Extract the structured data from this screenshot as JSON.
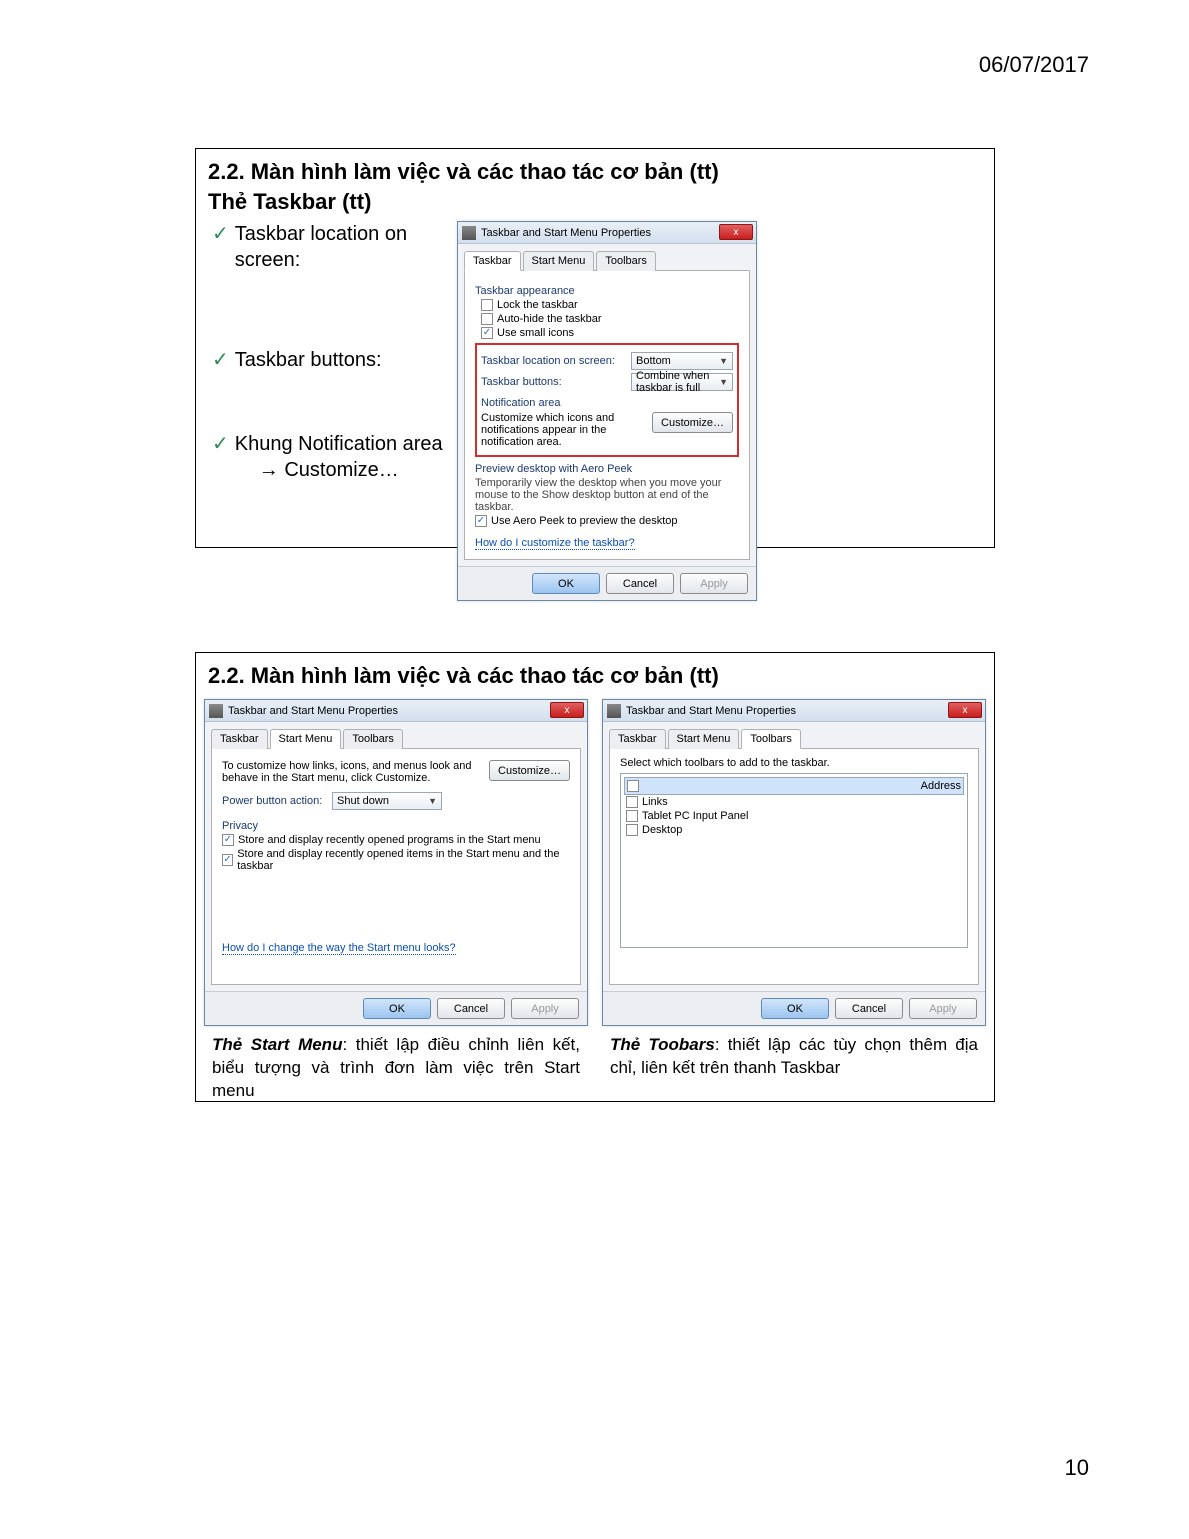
{
  "page": {
    "date": "06/07/2017",
    "number": "10"
  },
  "slide1": {
    "title": "2.2. Màn hình làm việc và các thao tác cơ bản (tt)",
    "subtitle": "Thẻ Taskbar (tt)",
    "bullets": {
      "b1": "Taskbar location on screen:",
      "b2": "Taskbar buttons:",
      "b3": "Khung Notification area",
      "b3sub": "→ Customize…"
    },
    "dlg": {
      "title": "Taskbar and Start Menu Properties",
      "close": "x",
      "tabs": {
        "t1": "Taskbar",
        "t2": "Start Menu",
        "t3": "Toolbars"
      },
      "appearance_head": "Taskbar appearance",
      "c_lock": "Lock the taskbar",
      "c_autohide": "Auto-hide the taskbar",
      "c_smallicons": "Use small icons",
      "loc_label": "Taskbar location on screen:",
      "loc_value": "Bottom",
      "btn_label": "Taskbar buttons:",
      "btn_value": "Combine when taskbar is full",
      "notif_head": "Notification area",
      "notif_text": "Customize which icons and notifications appear in the notification area.",
      "customize": "Customize…",
      "peek_head": "Preview desktop with Aero Peek",
      "peek_text": "Temporarily view the desktop when you move your mouse to the Show desktop button at end of the taskbar.",
      "c_peek": "Use Aero Peek to preview the desktop",
      "help": "How do I customize the taskbar?",
      "ok": "OK",
      "cancel": "Cancel",
      "apply": "Apply"
    }
  },
  "slide2": {
    "title": "2.2. Màn hình làm việc và các thao tác cơ bản (tt)",
    "dlgL": {
      "title": "Taskbar and Start Menu Properties",
      "close": "x",
      "tabs": {
        "t1": "Taskbar",
        "t2": "Start Menu",
        "t3": "Toolbars"
      },
      "intro": "To customize how links, icons, and menus look and behave in the Start menu, click Customize.",
      "customize": "Customize…",
      "pba_label": "Power button action:",
      "pba_value": "Shut down",
      "privacy_head": "Privacy",
      "c_priv1": "Store and display recently opened programs in the Start menu",
      "c_priv2": "Store and display recently opened items in the Start menu and the taskbar",
      "help": "How do I change the way the Start menu looks?",
      "ok": "OK",
      "cancel": "Cancel",
      "apply": "Apply"
    },
    "dlgR": {
      "title": "Taskbar and Start Menu Properties",
      "close": "x",
      "tabs": {
        "t1": "Taskbar",
        "t2": "Start Menu",
        "t3": "Toolbars"
      },
      "intro": "Select which toolbars to add to the taskbar.",
      "items": {
        "i1": "Address",
        "i2": "Links",
        "i3": "Tablet PC Input Panel",
        "i4": "Desktop"
      },
      "ok": "OK",
      "cancel": "Cancel",
      "apply": "Apply"
    },
    "capL_em": "Thẻ Start Menu",
    "capL": ": thiết lập điều chỉnh liên kết, biểu tượng và trình đơn làm việc trên Start menu",
    "capR_em": "Thẻ Toobars",
    "capR": ": thiết lập các tùy chọn thêm địa chỉ, liên kết trên thanh Taskbar"
  }
}
